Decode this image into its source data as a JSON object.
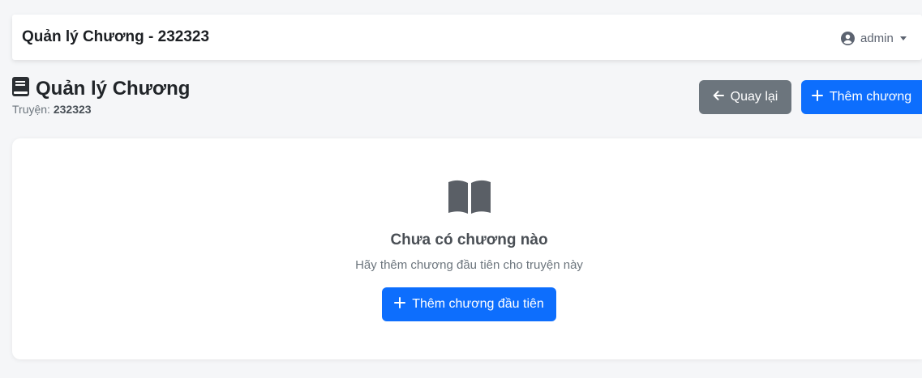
{
  "topbar": {
    "title": "Quản lý Chương - 232323"
  },
  "user": {
    "name": "admin",
    "icon": "user-circle-icon"
  },
  "page": {
    "title": "Quản lý Chương",
    "title_icon": "book-icon",
    "subtitle_label": "Truyện:",
    "subtitle_value": "232323"
  },
  "actions": {
    "back_label": "Quay lại",
    "back_icon": "arrow-left-icon",
    "add_label": "Thêm chương",
    "add_icon": "plus-icon"
  },
  "empty_state": {
    "icon": "open-book-icon",
    "title": "Chưa có chương nào",
    "description": "Hãy thêm chương đầu tiên cho truyện này",
    "button_label": "Thêm chương đầu tiên"
  },
  "colors": {
    "primary": "#0d6efd",
    "secondary": "#6c757d",
    "background": "#f5f6f8"
  }
}
